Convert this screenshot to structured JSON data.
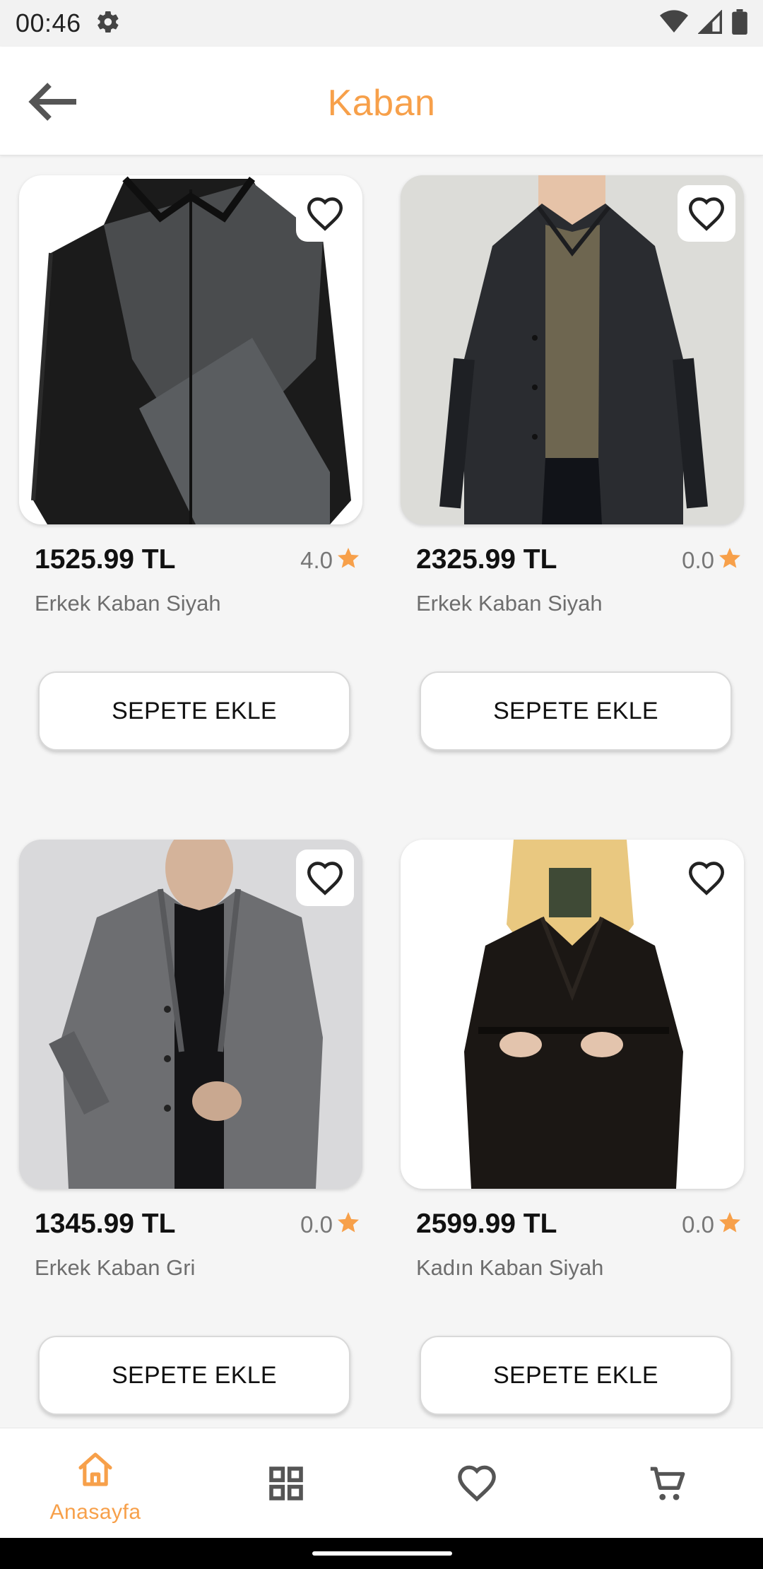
{
  "status_bar": {
    "time": "00:46",
    "icons": [
      "settings-gear-icon",
      "wifi-icon",
      "cellular-signal-icon",
      "battery-icon"
    ]
  },
  "app_bar": {
    "title": "Kaban",
    "back_icon": "arrow-left-icon"
  },
  "colors": {
    "accent": "#F7A04A",
    "background": "#F5F5F5",
    "card_button_bg": "#FFFFFF",
    "text_primary": "#111111",
    "text_secondary": "#6E6E6E",
    "nav_inactive": "#555555"
  },
  "products": [
    {
      "price": "1525.99 TL",
      "rating": "4.0",
      "name": "Erkek Kaban Siyah",
      "button_label": "SEPETE EKLE",
      "image": "black-grey-hooded-jacket-photo"
    },
    {
      "price": "2325.99 TL",
      "rating": "0.0",
      "name": "Erkek Kaban Siyah",
      "button_label": "SEPETE EKLE",
      "image": "man-black-coat-olive-sweater-photo"
    },
    {
      "price": "1345.99 TL",
      "rating": "0.0",
      "name": "Erkek Kaban Gri",
      "button_label": "SEPETE EKLE",
      "image": "man-grey-wool-coat-photo"
    },
    {
      "price": "2599.99 TL",
      "rating": "0.0",
      "name": "Kadın Kaban Siyah",
      "button_label": "SEPETE EKLE",
      "image": "woman-black-belted-coat-photo"
    }
  ],
  "bottom_nav": {
    "items": [
      {
        "label": "Anasayfa",
        "icon": "home-icon",
        "active": true
      },
      {
        "label": "",
        "icon": "grid-icon",
        "active": false
      },
      {
        "label": "",
        "icon": "heart-icon",
        "active": false
      },
      {
        "label": "",
        "icon": "cart-icon",
        "active": false
      }
    ]
  }
}
